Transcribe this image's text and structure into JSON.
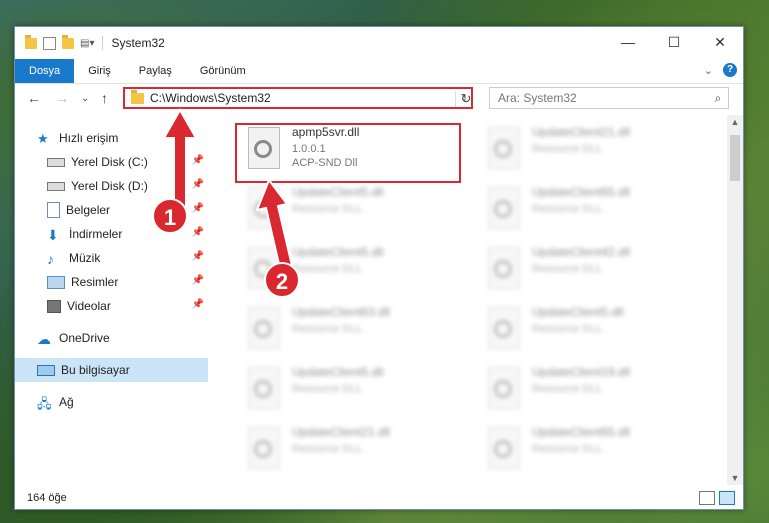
{
  "window": {
    "title": "System32"
  },
  "ribbon": {
    "tabs": [
      {
        "label": "Dosya"
      },
      {
        "label": "Giriş"
      },
      {
        "label": "Paylaş"
      },
      {
        "label": "Görünüm"
      }
    ],
    "help_label": "?"
  },
  "address": {
    "path": "C:\\Windows\\System32"
  },
  "search": {
    "placeholder": "Ara: System32"
  },
  "sidebar": {
    "items": [
      {
        "label": "Hızlı erişim",
        "icon": "star-icon"
      },
      {
        "label": "Yerel Disk (C:)",
        "icon": "drive-icon"
      },
      {
        "label": "Yerel Disk (D:)",
        "icon": "drive-icon"
      },
      {
        "label": "Belgeler",
        "icon": "document-icon"
      },
      {
        "label": "İndirmeler",
        "icon": "download-icon"
      },
      {
        "label": "Müzik",
        "icon": "music-icon"
      },
      {
        "label": "Resimler",
        "icon": "pictures-icon"
      },
      {
        "label": "Videolar",
        "icon": "video-icon"
      },
      {
        "label": "OneDrive",
        "icon": "cloud-icon"
      },
      {
        "label": "Bu bilgisayar",
        "icon": "computer-icon"
      },
      {
        "label": "Ağ",
        "icon": "network-icon"
      }
    ]
  },
  "files": {
    "primary": {
      "name": "apmp5svr.dll",
      "version": "1.0.0.1",
      "description": "ACP-SND Dll"
    },
    "left_col": [
      {
        "name": "UpdateClient5.dll",
        "description": "Resource DLL"
      },
      {
        "name": "UpdateClient5.dll",
        "description": "Resource DLL"
      },
      {
        "name": "UpdateClient63.dll",
        "description": "Resource DLL"
      },
      {
        "name": "UpdateClient5.dll",
        "description": "Resource DLL"
      },
      {
        "name": "UpdateClient21.dll",
        "description": "Resource DLL"
      }
    ],
    "right_col": [
      {
        "name": "UpdateClient21.dll",
        "description": "Resource DLL"
      },
      {
        "name": "UpdateClient65.dll",
        "description": "Resource DLL"
      },
      {
        "name": "UpdateClient42.dll",
        "description": "Resource DLL"
      },
      {
        "name": "UpdateClient5.dll",
        "description": "Resource DLL"
      },
      {
        "name": "UpdateClient19.dll",
        "description": "Resource DLL"
      },
      {
        "name": "UpdateClient65.dll",
        "description": "Resource DLL"
      }
    ]
  },
  "status": {
    "count": "164 öğe"
  },
  "callouts": {
    "one": "1",
    "two": "2"
  },
  "colors": {
    "accent": "#1979ca",
    "highlight": "#d9282f"
  }
}
